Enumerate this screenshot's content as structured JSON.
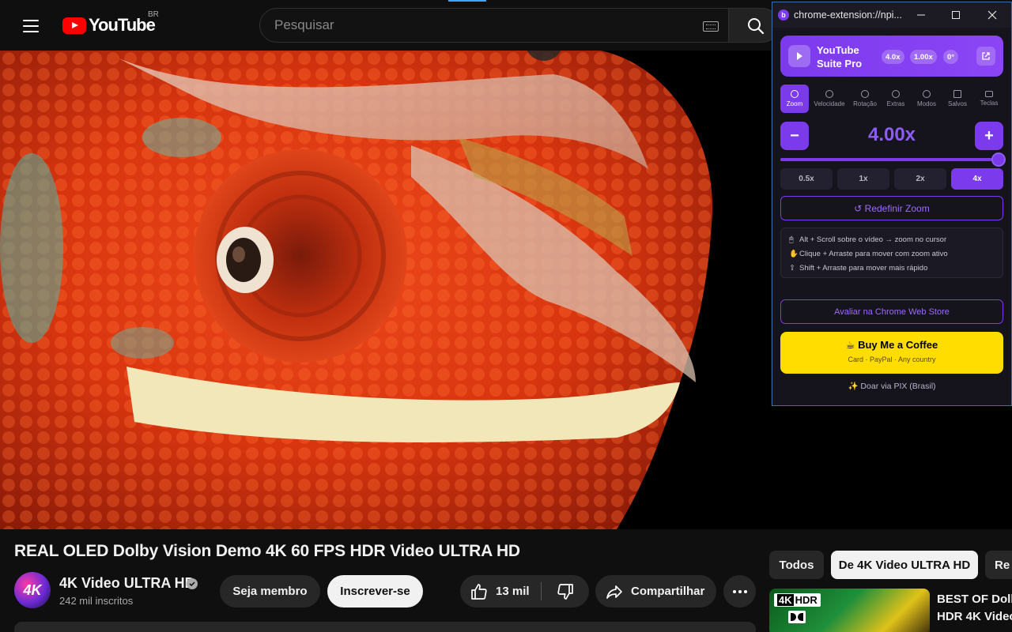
{
  "header": {
    "logo_text": "YouTube",
    "region": "BR",
    "search_placeholder": "Pesquisar"
  },
  "video": {
    "title": "REAL OLED Dolby Vision Demo 4K 60 FPS HDR Video ULTRA HD"
  },
  "channel": {
    "avatar_text": "4K",
    "name": "4K Video ULTRA HD",
    "subscribers": "242 mil inscritos",
    "join_label": "Seja membro",
    "subscribe_label": "Inscrever-se"
  },
  "actions": {
    "likes": "13 mil",
    "share_label": "Compartilhar"
  },
  "chips": [
    "Todos",
    "De 4K Video ULTRA HD",
    "Re"
  ],
  "recommendation": {
    "badge_4k": "4K",
    "badge_hdr": "HDR",
    "title_line1": "BEST OF Dolb",
    "title_line2": "HDR 4K Video"
  },
  "extension": {
    "favicon_text": "b",
    "window_url": "chrome-extension://npi...",
    "brand_line1": "YouTube",
    "brand_line2": "Suite Pro",
    "badges": [
      "4.0x",
      "1.00x",
      "0°"
    ],
    "tabs": [
      "Zoom",
      "Velocidade",
      "Rotação",
      "Extras",
      "Modos",
      "Salvos",
      "Teclas"
    ],
    "active_tab": "Zoom",
    "minus_label": "−",
    "plus_label": "+",
    "zoom_value": "4.00x",
    "zoom_level_fraction": 1.0,
    "presets": [
      "0.5x",
      "1x",
      "2x",
      "4x"
    ],
    "active_preset": "4x",
    "reset_label": "↺ Redefinir Zoom",
    "tips": [
      {
        "icon": "🖱",
        "text": "Alt + Scroll sobre o vídeo → zoom no cursor"
      },
      {
        "icon": "✋",
        "text": "Clique + Arraste para mover com zoom ativo"
      },
      {
        "icon": "⇧",
        "text": "Shift + Arraste para mover mais rápido"
      }
    ],
    "rate_label": "Avaliar na Chrome Web Store",
    "coffee_title": "☕ Buy Me a Coffee",
    "coffee_sub": "Card · PayPal · Any country",
    "pix_label": "✨ Doar via PIX (Brasil)"
  },
  "colors": {
    "accent": "#7c3aed",
    "youtube_red": "#ff0000",
    "coffee_yellow": "#ffdd00"
  }
}
